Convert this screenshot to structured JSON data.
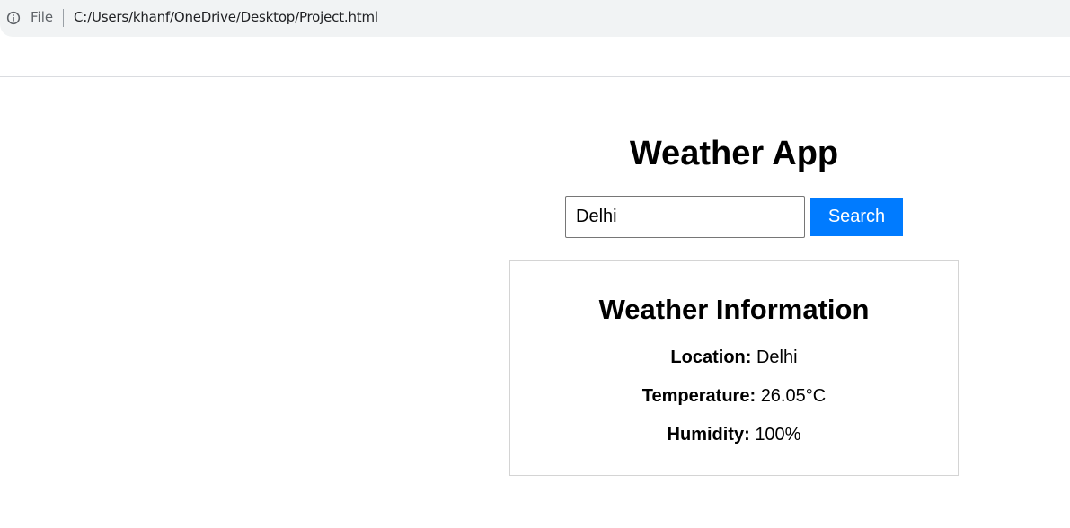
{
  "browser": {
    "scheme_label": "File",
    "url": "C:/Users/khanf/OneDrive/Desktop/Project.html",
    "info_icon": "info-circle-icon"
  },
  "app": {
    "title": "Weather App",
    "search": {
      "value": "Delhi",
      "button_label": "Search"
    },
    "card": {
      "title": "Weather Information",
      "rows": [
        {
          "label": "Location:",
          "value": "Delhi"
        },
        {
          "label": "Temperature:",
          "value": "26.05°C"
        },
        {
          "label": "Humidity:",
          "value": "100%"
        }
      ]
    },
    "colors": {
      "button": "#007bff",
      "button_text": "#ffffff"
    }
  }
}
